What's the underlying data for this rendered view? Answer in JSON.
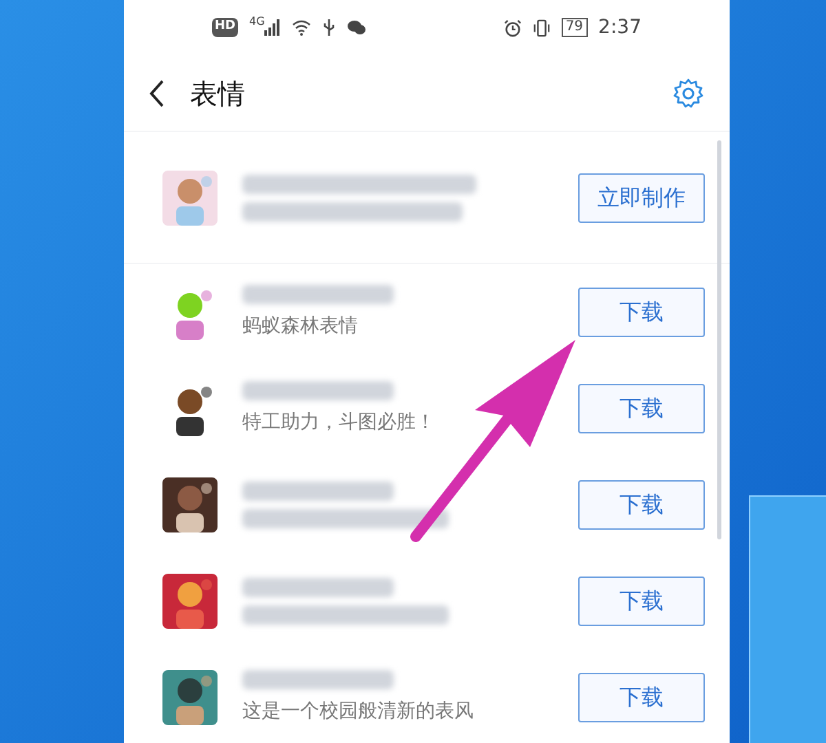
{
  "status_bar": {
    "hd": "HD",
    "network": "4G",
    "battery": "79",
    "time": "2:37"
  },
  "header": {
    "title": "表情"
  },
  "items": [
    {
      "kind": "make",
      "button": "立即制作"
    },
    {
      "kind": "download",
      "subtitle": "蚂蚁森林表情",
      "button": "下载"
    },
    {
      "kind": "download",
      "subtitle": "特工助力，斗图必胜！",
      "button": "下载"
    },
    {
      "kind": "download",
      "button": "下载"
    },
    {
      "kind": "download",
      "button": "下载"
    },
    {
      "kind": "download",
      "subtitle": "这是一个校园般清新的表风",
      "button": "下载"
    }
  ]
}
